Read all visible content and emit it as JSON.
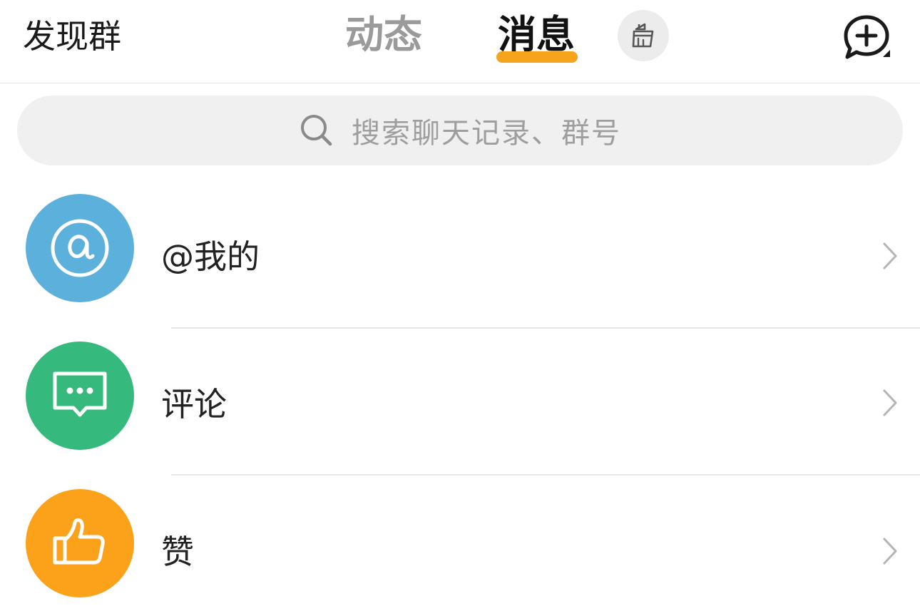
{
  "header": {
    "discover_label": "发现群",
    "tabs": [
      {
        "label": "动态",
        "active": false
      },
      {
        "label": "消息",
        "active": true
      }
    ],
    "clean_icon": "broom-icon",
    "add_icon": "chat-plus-icon",
    "active_tab_color": "#f7a41d"
  },
  "search": {
    "placeholder": "搜索聊天记录、群号",
    "icon": "search-icon"
  },
  "list": {
    "items": [
      {
        "label": "@我的",
        "icon": "at-icon",
        "color": "#5bb0dc"
      },
      {
        "label": "评论",
        "icon": "comment-icon",
        "color": "#35b97c"
      },
      {
        "label": "赞",
        "icon": "thumbs-up-icon",
        "color": "#fba11a"
      }
    ]
  }
}
